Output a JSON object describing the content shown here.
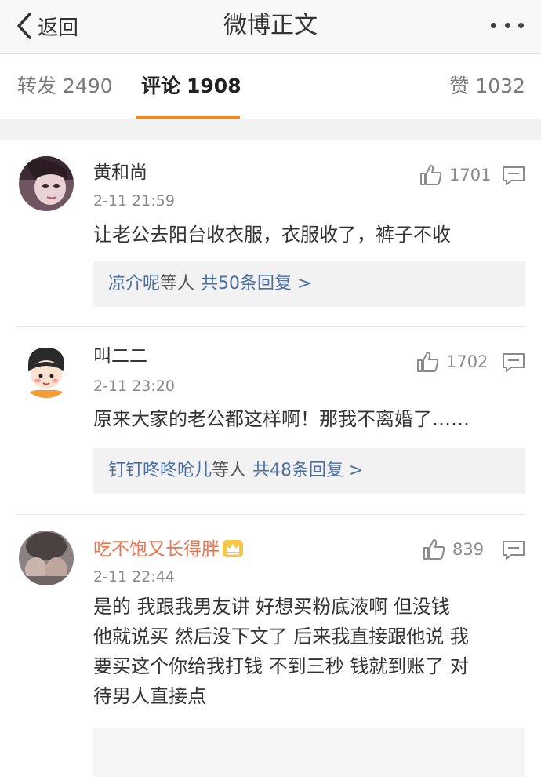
{
  "nav": {
    "back_label": "返回",
    "title": "微博正文"
  },
  "tabs": {
    "repost": {
      "label": "转发",
      "count": "2490"
    },
    "comment": {
      "label": "评论",
      "count": "1908"
    },
    "like": {
      "label": "赞",
      "count": "1032"
    }
  },
  "accent_color": "#f08a1f",
  "comments": [
    {
      "user": "黄和尚",
      "time": "2-11 21:59",
      "likes": "1701",
      "text": "让老公去阳台收衣服，衣服收了，裤子不收",
      "replies": {
        "who": "凉介呢",
        "etc": "等人",
        "count": "共50条回复 >"
      }
    },
    {
      "user": "叫二二",
      "time": "2-11 23:20",
      "likes": "1702",
      "text": "原来大家的老公都这样啊！那我不离婚了……",
      "replies": {
        "who": "钉钉咚咚呛儿",
        "etc": "等人",
        "count": "共48条回复 >"
      }
    },
    {
      "user": "吃不饱又长得胖",
      "time": "2-11 22:44",
      "likes": "839",
      "text_lines": [
        "是的 我跟我男友讲 好想买粉底液啊 但没钱",
        "他就说买 然后没下文了 后来我直接跟他说 我",
        "要买这个你给我打钱 不到三秒 钱就到账了 对",
        "待男人直接点"
      ]
    }
  ]
}
